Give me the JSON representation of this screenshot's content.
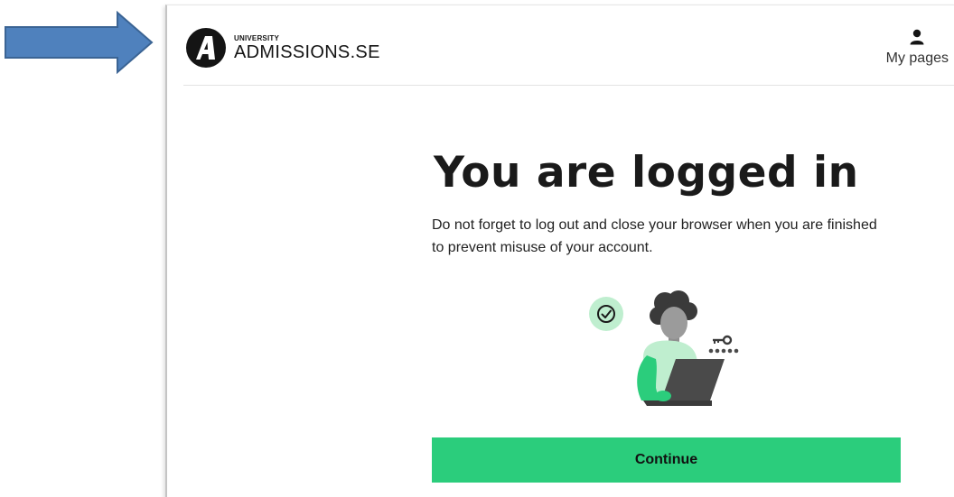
{
  "header": {
    "logo": {
      "mark_letter": "A",
      "small_text": "UNIVERSITY",
      "big_text": "ADMISSIONS.SE"
    },
    "my_pages_label": "My pages",
    "my_pages_icon": "person-icon"
  },
  "main": {
    "title": "You are logged in",
    "message": "Do not forget to log out and close your browser when you are finished to prevent misuse of your account.",
    "illustration_icons": [
      "check-circle-icon",
      "key-icon",
      "password-dots-icon",
      "laptop-icon"
    ],
    "continue_label": "Continue"
  },
  "annotation": {
    "arrow_color": "#4f81bd",
    "arrow_icon": "right-arrow-icon"
  },
  "colors": {
    "accent": "#2bcd7c",
    "accent_light": "#bfeecf",
    "text": "#1a1a1a",
    "logo": "#141414"
  }
}
